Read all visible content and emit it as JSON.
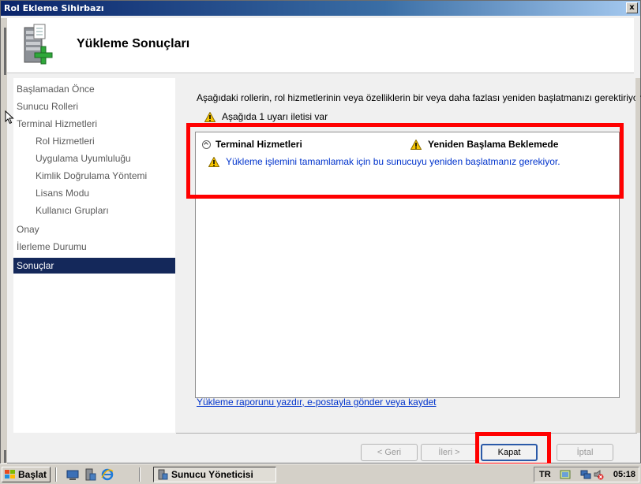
{
  "window": {
    "title": "Rol Ekleme Sihirbazı",
    "close_glyph": "x",
    "header_title": "Yükleme Sonuçları"
  },
  "sidebar": {
    "items": [
      {
        "label": "Başlamadan Önce"
      },
      {
        "label": "Sunucu Rolleri"
      },
      {
        "label": "Terminal Hizmetleri"
      },
      {
        "label": "Rol Hizmetleri"
      },
      {
        "label": "Uygulama Uyumluluğu"
      },
      {
        "label": "Kimlik Doğrulama Yöntemi"
      },
      {
        "label": "Lisans Modu"
      },
      {
        "label": "Kullanıcı Grupları"
      },
      {
        "label": "Onay"
      },
      {
        "label": "İlerleme Durumu"
      },
      {
        "label": "Sonuçlar"
      }
    ],
    "active_index": 10
  },
  "main": {
    "intro": "Aşağıdaki rollerin, rol hizmetlerinin veya özelliklerin bir veya daha fazlası yeniden başlatmanızı gerektiriyor:",
    "warning_summary": "Aşağıda 1 uyarı iletisi var",
    "results": [
      {
        "name": "Terminal Hizmetleri",
        "status": "Yeniden Başlama Beklemede",
        "message": "Yükleme işlemini tamamlamak için bu sunucuyu yeniden başlatmanız gerekiyor."
      }
    ],
    "report_link": "Yükleme raporunu yazdır, e-postayla gönder veya kaydet"
  },
  "buttons": {
    "back": "< Geri",
    "next": "İleri >",
    "close": "Kapat",
    "cancel": "İptal"
  },
  "taskbar": {
    "start_label": "Başlat",
    "task_label": "Sunucu Yöneticisi",
    "language": "TR",
    "clock": "05:18"
  },
  "colors": {
    "highlight": "#ff0000",
    "active_nav": "#14285a",
    "link": "#0033cc"
  }
}
